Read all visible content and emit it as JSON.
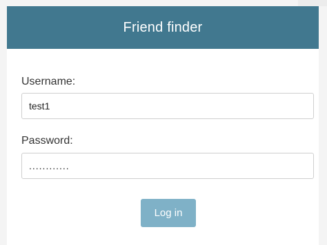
{
  "header": {
    "title": "Friend finder"
  },
  "form": {
    "username_label": "Username:",
    "username_value": "test1",
    "password_label": "Password:",
    "password_value": "............",
    "login_label": "Log in"
  },
  "colors": {
    "header_bg": "#41788f",
    "button_bg": "#7fb1c7",
    "page_bg": "#f4f4f4"
  }
}
